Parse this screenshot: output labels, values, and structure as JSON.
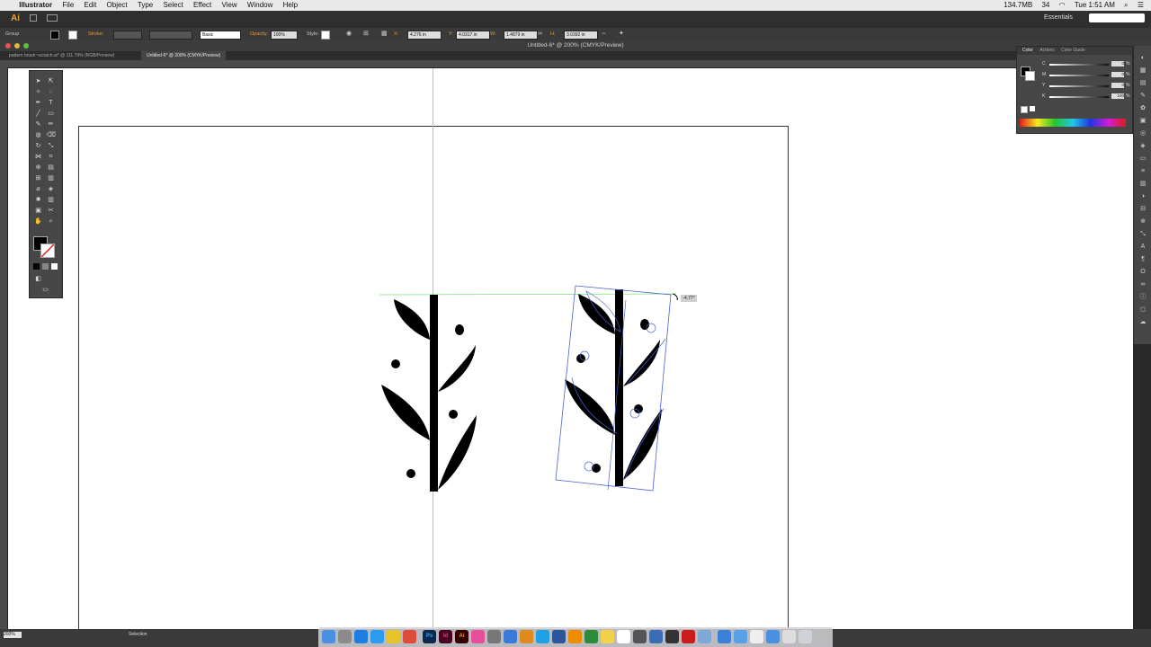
{
  "menubar": {
    "apple": "",
    "app_name": "Illustrator",
    "items": [
      "File",
      "Edit",
      "Object",
      "Type",
      "Select",
      "Effect",
      "View",
      "Window",
      "Help"
    ],
    "status": {
      "memory": "134.7MB",
      "count": "34",
      "clock": "Tue 1:51 AM"
    }
  },
  "appbar": {
    "logo": "Ai",
    "workspace": "Essentials"
  },
  "controlbar": {
    "selection_label": "Group",
    "stroke_label": "Stroke:",
    "brush_label": "Basic",
    "opacity_label": "Opacity:",
    "opacity_value": "100%",
    "style_label": "Style:",
    "x_label": "X:",
    "x_value": "4.276 in",
    "y_label": "Y:",
    "y_value": "4.0317 in",
    "w_label": "W:",
    "w_value": "1.4879 in",
    "h_label": "H:",
    "h_value": "3.0392 in"
  },
  "window": {
    "title": "Untitled-6* @ 200% (CMYK/Preview)"
  },
  "tabs": [
    {
      "label": "pattern brush~scratch.ai* @ 111.79% (RGB/Preview)",
      "active": false
    },
    {
      "label": "Untitled-6* @ 200% (CMYK/Preview)",
      "active": true
    }
  ],
  "canvas": {
    "rotation_readout": "-4.77°"
  },
  "color_panel": {
    "tabs": [
      "Color",
      "Actions",
      "Color Guide"
    ],
    "channels": [
      {
        "key": "C",
        "value": "0",
        "unit": "%"
      },
      {
        "key": "M",
        "value": "0",
        "unit": "%"
      },
      {
        "key": "Y",
        "value": "0",
        "unit": "%"
      },
      {
        "key": "K",
        "value": "100",
        "unit": "%"
      }
    ]
  },
  "statusbar": {
    "zoom": "200%",
    "tool": "Selection"
  },
  "colors": {
    "accent": "#e59b36",
    "guide": "#7fd6f0",
    "selection": "#4a5fd6",
    "smart_guide": "#7ee07e"
  },
  "dock": {
    "apps": [
      "finder",
      "launchpad",
      "safari",
      "app-store",
      "photos",
      "chrome",
      "photoshop",
      "indesign",
      "illustrator",
      "itunes",
      "settings",
      "network",
      "books",
      "skype",
      "word",
      "vlc",
      "keynote",
      "notes",
      "calendar",
      "acrobat",
      "maps",
      "folder",
      "system",
      "finder2",
      "chrome2",
      "folder2",
      "downloads",
      "notes2",
      "trash"
    ]
  }
}
